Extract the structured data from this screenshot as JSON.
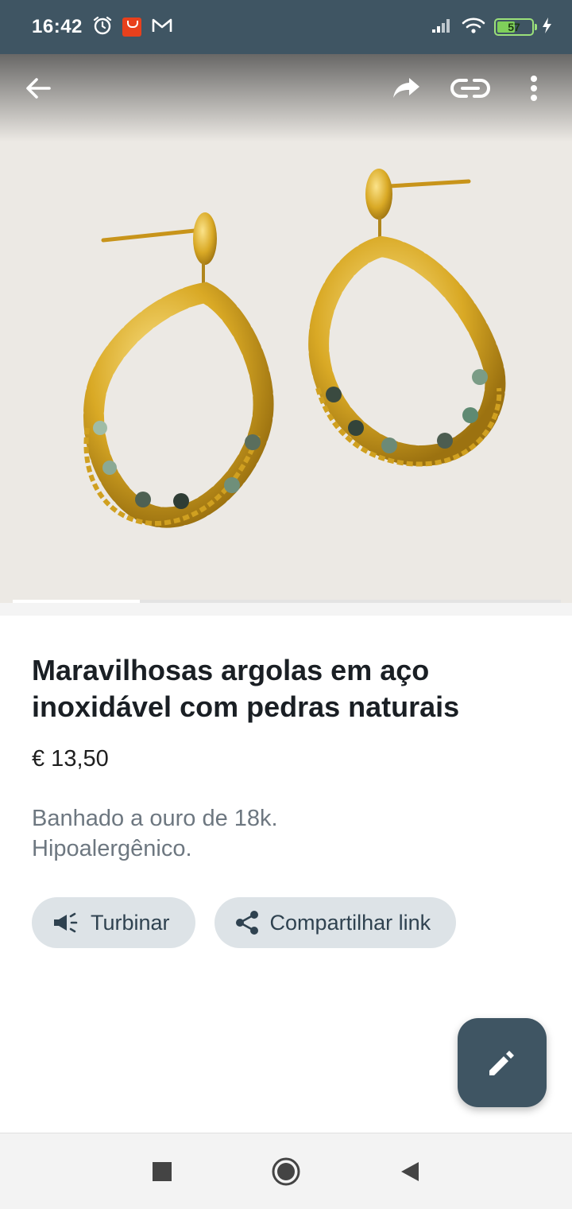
{
  "status_bar": {
    "time": "16:42",
    "left_icons": [
      "alarm-icon",
      "aliexpress-icon",
      "gmail-icon"
    ],
    "right_icons": [
      "signal-icon",
      "wifi-icon",
      "battery-icon",
      "charging-icon"
    ],
    "battery_level": "57",
    "battery_fraction": 0.57
  },
  "toolbar": {
    "back_icon": "arrow-left-icon",
    "actions": [
      "share-forward-icon",
      "link-icon",
      "more-vert-icon"
    ]
  },
  "image": {
    "description_icon": "product-photo-earrings",
    "indicator_position": 1
  },
  "product": {
    "title": "Maravilhosas argolas em aço inoxidável com pedras naturais",
    "price": "€ 13,50",
    "description": "Banhado a ouro de 18k.\nHipoalergênico."
  },
  "buttons": {
    "boost_label": "Turbinar",
    "boost_icon": "megaphone-icon",
    "share_link_label": "Compartilhar link",
    "share_icon": "share-icon"
  },
  "fab": {
    "icon": "edit-pencil-icon"
  },
  "nav_bar": {
    "items": [
      "recent-apps-icon",
      "home-icon",
      "back-icon"
    ]
  },
  "colors": {
    "primary": "#3f5563",
    "chip_background": "#dde3e7",
    "image_background": "#ece9e4",
    "gold": "#d9a925"
  }
}
